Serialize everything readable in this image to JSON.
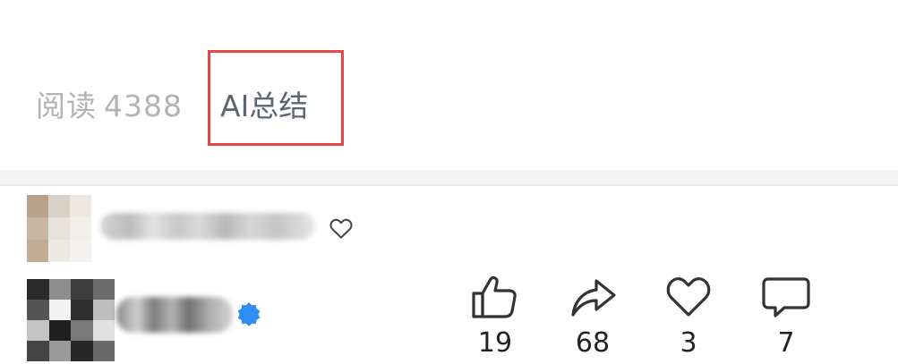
{
  "meta": {
    "read_label": "阅读",
    "read_count": "4388",
    "ai_summary_label": "AI总结",
    "highlight_color": "#e8474a"
  },
  "comment_preview": {
    "avatar_icon": "avatar-icon",
    "name_obscured": true,
    "like_icon": "heart-outline-icon"
  },
  "author": {
    "avatar_icon": "avatar-icon",
    "name_obscured": true,
    "badge_icon": "verified-badge-icon",
    "badge_color": "#2f8cf0"
  },
  "actions": [
    {
      "name": "like",
      "icon": "thumbs-up-icon",
      "count": "19"
    },
    {
      "name": "share",
      "icon": "share-arrow-icon",
      "count": "68"
    },
    {
      "name": "favorite",
      "icon": "heart-outline-icon",
      "count": "3"
    },
    {
      "name": "comment",
      "icon": "comment-bubble-icon",
      "count": "7"
    }
  ]
}
